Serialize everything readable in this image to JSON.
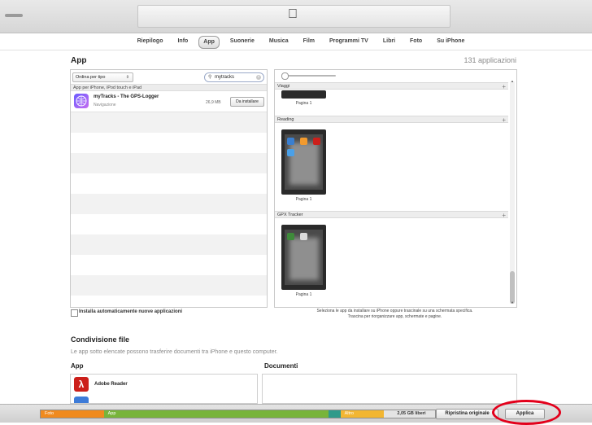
{
  "tabs": [
    {
      "label": "Riepilogo",
      "active": false
    },
    {
      "label": "Info",
      "active": false
    },
    {
      "label": "App",
      "active": true
    },
    {
      "label": "Suonerie",
      "active": false
    },
    {
      "label": "Musica",
      "active": false
    },
    {
      "label": "Film",
      "active": false
    },
    {
      "label": "Programmi TV",
      "active": false
    },
    {
      "label": "Libri",
      "active": false
    },
    {
      "label": "Foto",
      "active": false
    },
    {
      "label": "Su iPhone",
      "active": false
    }
  ],
  "apps": {
    "title": "App",
    "count": "131 applicazioni",
    "sort_value": "Ordina per tipo",
    "search_value": "mytracks",
    "list_header": "App per iPhone, iPod touch e iPad",
    "item": {
      "name": "myTracks - The GPS-Logger",
      "category": "Navigazione",
      "size": "26,9 MB",
      "action": "Da installare"
    }
  },
  "pages": [
    {
      "group": "Viaggi",
      "label": "Pagina 1"
    },
    {
      "group": "Reading",
      "label": "Pagina 1"
    },
    {
      "group": "GPX Tracker",
      "label": "Pagina 1"
    }
  ],
  "auto_install_label": "Installa automaticamente nuove applicazioni",
  "hint_lines": [
    "Seleziona le app da installare su iPhone oppure trascinale su una schermata specifica.",
    "Trascina per riorganizzare app, schermate e pagine."
  ],
  "file_sharing": {
    "title": "Condivisione file",
    "description": "Le app sotto elencate possono trasferire documenti tra iPhone e questo computer.",
    "app_col": "App",
    "docs_col": "Documenti",
    "app_item": "Adobe Reader"
  },
  "capacity": {
    "segments": [
      {
        "label": "Foto",
        "color": "#f08a1e",
        "share": 0.16
      },
      {
        "label": "App",
        "color": "#78b43a",
        "share": 0.57
      },
      {
        "label": "",
        "color": "#2f9a8a",
        "share": 0.03
      },
      {
        "label": "Altro",
        "color": "#f2b632",
        "share": 0.11
      },
      {
        "label": "2,05 GB liberi",
        "color": "#e4e4e4",
        "share": 0.13
      }
    ]
  },
  "buttons": {
    "restore": "Ripristina originale",
    "apply": "Applica"
  },
  "annotation_color": "#e3001b"
}
